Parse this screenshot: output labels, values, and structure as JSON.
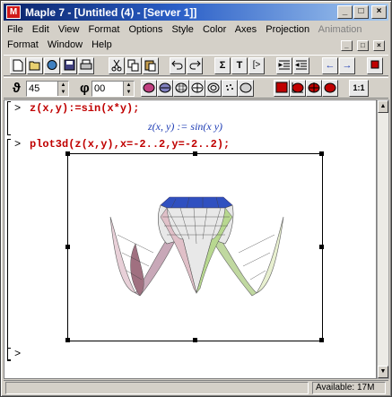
{
  "window": {
    "title": "Maple 7 - [Untitled (4) - [Server 1]]",
    "app_icon_glyph": "M"
  },
  "menu": {
    "row1": [
      "File",
      "Edit",
      "View",
      "Format",
      "Options",
      "Style",
      "Color",
      "Axes",
      "Projection",
      "Animation"
    ],
    "row2": [
      "Format",
      "Window",
      "Help"
    ],
    "disabled": [
      "Animation"
    ]
  },
  "toolbar1": {
    "icons": [
      "new-icon",
      "open-icon",
      "open-url-icon",
      "save-icon",
      "print-icon",
      "cut-icon",
      "copy-icon",
      "paste-icon",
      "undo-icon",
      "redo-icon",
      "sigma-icon",
      "text-icon",
      "prompt-icon",
      "indent-icon",
      "outdent-icon",
      "back-icon",
      "forward-icon",
      "stop-icon"
    ],
    "labels": {
      "sigma": "Σ",
      "text": "T",
      "prompt": "[>",
      "back": "←",
      "forward": "→"
    }
  },
  "toolbar2": {
    "theta_label": "ϑ",
    "theta_value": "45",
    "phi_label": "φ",
    "phi_value": "00",
    "style_buttons": [
      "patch-icon",
      "patch-contour-icon",
      "wireframe-icon",
      "hidden-line-icon",
      "contour-icon",
      "point-icon",
      "no-lighting-icon",
      "lighting-scheme-icon",
      "axes-boxed-icon",
      "axes-frame-icon",
      "axes-normal-icon",
      "axes-none-icon",
      "constrained-icon"
    ],
    "constrained_label": "1:1"
  },
  "worksheet": {
    "prompt_symbol": ">",
    "input1": "z(x,y):=sin(x*y);",
    "output1": "z(x, y) := sin(x y)",
    "input2": "plot3d(z(x,y),x=-2..2,y=-2..2);",
    "prompt3": ">"
  },
  "colors": {
    "input_text": "#c00000",
    "output_text": "#1e3cb4",
    "titlebar_start": "#0a246a",
    "titlebar_end": "#a6caf0"
  },
  "status": {
    "left": "",
    "available": "Available: 17M"
  },
  "window_buttons": {
    "minimize": "_",
    "maximize": "□",
    "close": "×"
  }
}
